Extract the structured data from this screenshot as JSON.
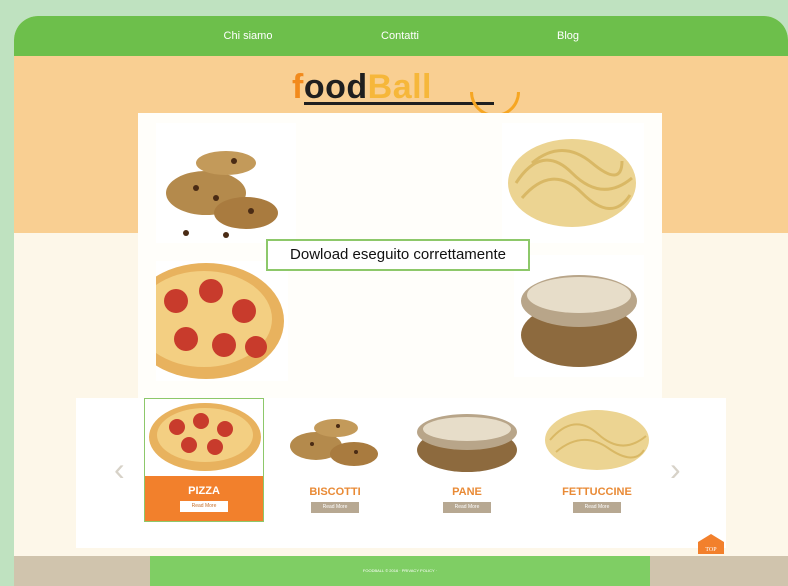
{
  "nav": {
    "items": [
      {
        "label": "Chi siamo"
      },
      {
        "label": "Contatti"
      },
      {
        "label": "Blog"
      }
    ]
  },
  "logo": {
    "part1": "f",
    "part2": "ood",
    "part3": "Ball"
  },
  "toast": {
    "message": "Dowload eseguito correttamente"
  },
  "carousel": {
    "cards": [
      {
        "label": "PIZZA",
        "button": "Read More",
        "active": true,
        "icon": "pizza-image"
      },
      {
        "label": "BISCOTTI",
        "button": "Read More",
        "active": false,
        "icon": "cookies-image"
      },
      {
        "label": "PANE",
        "button": "Read More",
        "active": false,
        "icon": "bread-image"
      },
      {
        "label": "FETTUCCINE",
        "button": "Read More",
        "active": false,
        "icon": "pasta-image"
      }
    ],
    "prev_icon": "chevron-left-icon",
    "next_icon": "chevron-right-icon"
  },
  "footer": {
    "text": "FOODBALL ©  2016  ·  PRIVACY POLICY  ·"
  },
  "top_button": {
    "label": "TOP"
  },
  "colors": {
    "nav_green": "#6dbf4b",
    "orange": "#f2802c",
    "band": "#f9cf92",
    "footer_green": "#7fce64"
  }
}
